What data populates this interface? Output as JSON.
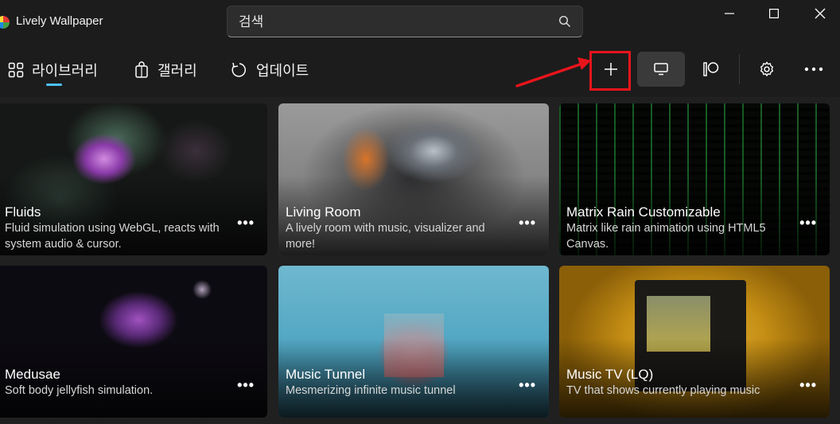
{
  "app": {
    "title": "Lively Wallpaper"
  },
  "search": {
    "placeholder": "검색"
  },
  "nav": {
    "library": "라이브러리",
    "gallery": "갤러리",
    "update": "업데이트"
  },
  "toolbar": {
    "icons": [
      "add-icon",
      "monitor-icon",
      "patreon-icon",
      "gear-icon",
      "more-icon"
    ],
    "highlight_color": "#e8141c",
    "accent": "#4cc2ff"
  },
  "window_controls": [
    "minimize",
    "maximize",
    "close"
  ],
  "wallpapers": [
    {
      "title": "Fluids",
      "desc": "Fluid simulation using WebGL, reacts with system audio & cursor."
    },
    {
      "title": "Living Room",
      "desc": "A lively room with music, visualizer and more!"
    },
    {
      "title": "Matrix Rain Customizable",
      "desc": "Matrix like rain animation using HTML5 Canvas."
    },
    {
      "title": "Medusae",
      "desc": "Soft body jellyfish simulation."
    },
    {
      "title": "Music Tunnel",
      "desc": "Mesmerizing infinite music tunnel"
    },
    {
      "title": "Music TV (LQ)",
      "desc": "TV that shows currently playing music"
    }
  ],
  "more_label": "•••"
}
